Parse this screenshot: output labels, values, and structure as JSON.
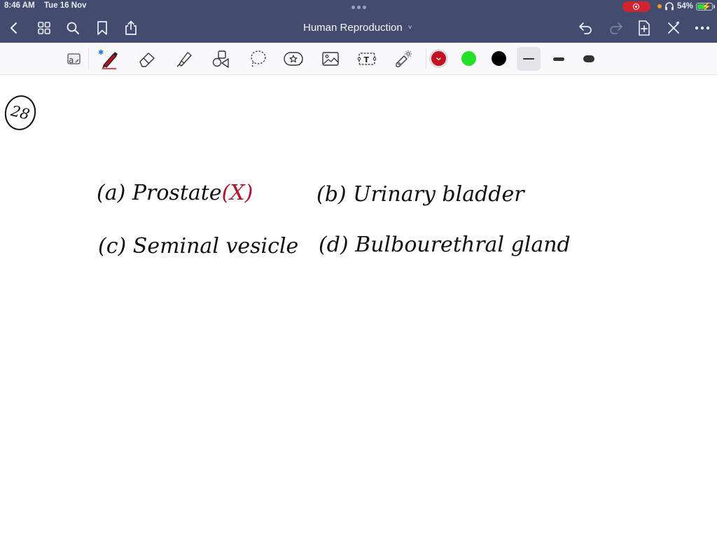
{
  "status_bar": {
    "time": "8:46 AM",
    "date": "Tue 16 Nov",
    "battery_percent": "54%",
    "battery_level": 0.54,
    "battery_charging": true,
    "recording": true,
    "headphones_connected": true
  },
  "header": {
    "title": "Human Reproduction",
    "title_chevron": "˅",
    "left_buttons": [
      {
        "name": "back",
        "icon": "chevron-left-icon"
      },
      {
        "name": "thumbnails",
        "icon": "grid-icon"
      },
      {
        "name": "search",
        "icon": "search-icon"
      },
      {
        "name": "bookmark",
        "icon": "bookmark-icon"
      },
      {
        "name": "share",
        "icon": "share-icon"
      }
    ],
    "right_buttons": [
      {
        "name": "undo",
        "icon": "undo-icon",
        "enabled": true
      },
      {
        "name": "redo",
        "icon": "redo-icon",
        "enabled": false
      },
      {
        "name": "add-page",
        "icon": "add-page-icon",
        "enabled": true
      },
      {
        "name": "close-pen-mode",
        "icon": "close-pen-icon",
        "enabled": true
      },
      {
        "name": "more",
        "icon": "more-icon",
        "enabled": true
      }
    ]
  },
  "toolbar": {
    "tools": [
      {
        "name": "read-only-mode",
        "icon": "read-mode-icon"
      },
      {
        "name": "pen",
        "icon": "pen-icon",
        "selected": true,
        "bluetooth": true
      },
      {
        "name": "eraser",
        "icon": "eraser-icon"
      },
      {
        "name": "highlighter",
        "icon": "highlighter-icon"
      },
      {
        "name": "shapes",
        "icon": "shapes-icon"
      },
      {
        "name": "lasso",
        "icon": "lasso-icon"
      },
      {
        "name": "elements",
        "icon": "sticker-icon"
      },
      {
        "name": "image",
        "icon": "image-icon"
      },
      {
        "name": "text",
        "icon": "text-box-icon",
        "label": "T"
      },
      {
        "name": "laser-pointer",
        "icon": "laser-pointer-icon"
      }
    ],
    "colors": [
      {
        "name": "red",
        "hex": "#c1121f",
        "selected": true
      },
      {
        "name": "green",
        "hex": "#22e02a",
        "selected": false
      },
      {
        "name": "black",
        "hex": "#000000",
        "selected": false
      }
    ],
    "stroke_widths": [
      {
        "name": "thin",
        "selected": true
      },
      {
        "name": "medium",
        "selected": false
      },
      {
        "name": "thick",
        "selected": false
      }
    ]
  },
  "page": {
    "question_number": "28",
    "options": [
      {
        "label": "(a)",
        "text": "Prostate",
        "mark": "(X)",
        "mark_color": "#b0132a"
      },
      {
        "label": "(b)",
        "text": "Urinary bladder"
      },
      {
        "label": "(c)",
        "text": "Seminal vesicle"
      },
      {
        "label": "(d)",
        "text": "Bulbourethral gland"
      }
    ]
  }
}
